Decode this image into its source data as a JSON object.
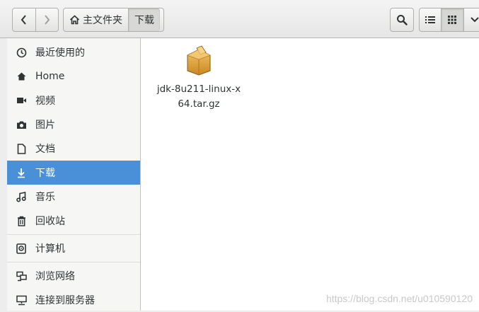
{
  "header": {
    "path": {
      "home_label": "主文件夹",
      "current_label": "下载"
    }
  },
  "sidebar": {
    "items": [
      {
        "label": "最近使用的",
        "icon": "recent-clock-icon"
      },
      {
        "label": "Home",
        "icon": "home-icon"
      },
      {
        "label": "视频",
        "icon": "video-icon"
      },
      {
        "label": "图片",
        "icon": "camera-icon"
      },
      {
        "label": "文档",
        "icon": "document-icon"
      },
      {
        "label": "下载",
        "icon": "download-icon",
        "active": true
      },
      {
        "label": "音乐",
        "icon": "music-icon"
      },
      {
        "label": "回收站",
        "icon": "trash-icon"
      },
      {
        "label": "计算机",
        "icon": "computer-icon"
      },
      {
        "label": "浏览网络",
        "icon": "network-icon"
      },
      {
        "label": "连接到服务器",
        "icon": "server-icon"
      }
    ]
  },
  "files": [
    {
      "name": "jdk-8u211-linux-x64.tar.gz",
      "icon": "archive-package-icon"
    }
  ],
  "watermark": "https://blog.csdn.net/u010590120",
  "colors": {
    "accent": "#4a90d9"
  }
}
